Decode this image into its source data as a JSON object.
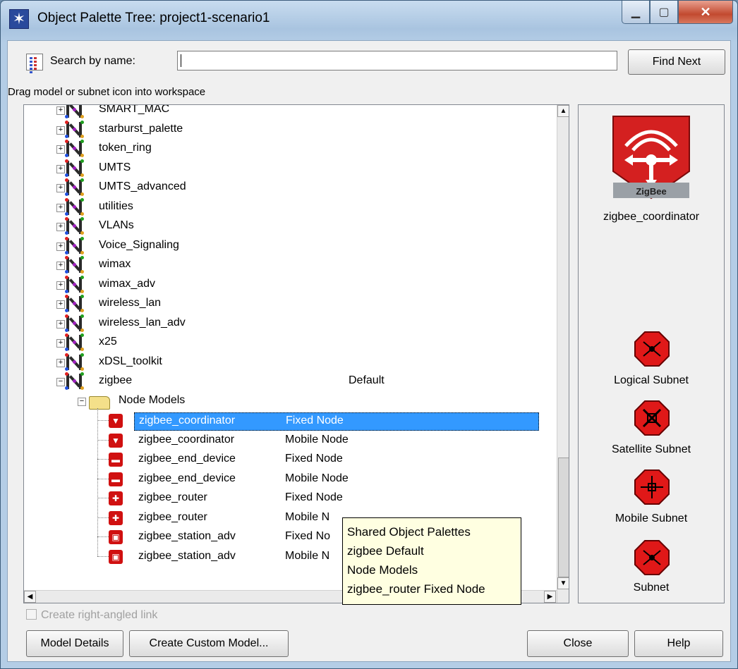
{
  "window": {
    "title": "Object Palette Tree: project1-scenario1"
  },
  "search": {
    "label": "Search by name:",
    "value": "",
    "find_next_label": "Find Next"
  },
  "drag_hint": "Drag model or subnet icon into workspace",
  "tree": {
    "palettes": [
      "SMART_MAC",
      "starburst_palette",
      "token_ring",
      "UMTS",
      "UMTS_advanced",
      "utilities",
      "VLANs",
      "Voice_Signaling",
      "wimax",
      "wimax_adv",
      "wireless_lan",
      "wireless_lan_adv",
      "x25",
      "xDSL_toolkit"
    ],
    "expanded": {
      "name": "zigbee",
      "type": "Default"
    },
    "folder": "Node Models",
    "nodes": [
      {
        "name": "zigbee_coordinator",
        "type": "Fixed Node",
        "selected": true
      },
      {
        "name": "zigbee_coordinator",
        "type": "Mobile Node"
      },
      {
        "name": "zigbee_end_device",
        "type": "Fixed Node"
      },
      {
        "name": "zigbee_end_device",
        "type": "Mobile Node"
      },
      {
        "name": "zigbee_router",
        "type": "Fixed Node"
      },
      {
        "name": "zigbee_router",
        "type": "Mobile N"
      },
      {
        "name": "zigbee_station_adv",
        "type": "Fixed No"
      },
      {
        "name": "zigbee_station_adv",
        "type": "Mobile N"
      }
    ]
  },
  "tooltip": {
    "lines": [
      "Shared Object Palettes",
      "zigbee Default",
      "Node Models",
      "zigbee_router Fixed Node"
    ]
  },
  "preview": {
    "badge": "ZigBee",
    "name": "zigbee_coordinator",
    "subnets": [
      "Logical Subnet",
      "Satellite Subnet",
      "Mobile Subnet",
      "Subnet"
    ],
    "accent_color": "#e01818"
  },
  "checkbox": {
    "label": "Create right-angled link",
    "checked": false,
    "enabled": false
  },
  "buttons": {
    "model_details": "Model Details",
    "create_custom": "Create Custom Model...",
    "close": "Close",
    "help": "Help"
  }
}
